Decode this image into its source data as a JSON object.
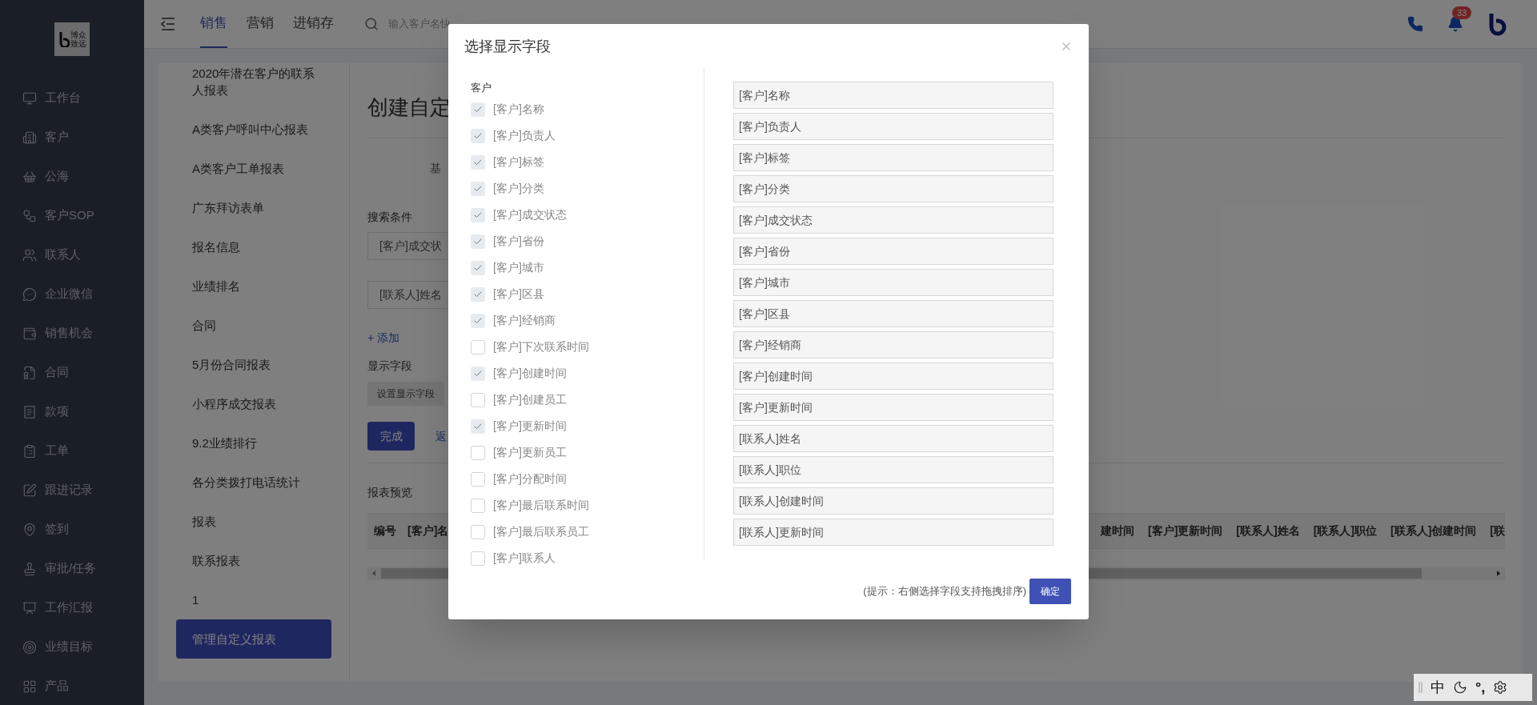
{
  "sidebar": {
    "logo_text": "博众致远",
    "items": [
      {
        "label": "工作台",
        "kind": "monitor"
      },
      {
        "label": "客户",
        "kind": "building"
      },
      {
        "label": "公海",
        "kind": "basket"
      },
      {
        "label": "客户SOP",
        "kind": "sop"
      },
      {
        "label": "联系人",
        "kind": "users"
      },
      {
        "label": "企业微信",
        "kind": "chat"
      },
      {
        "label": "销售机会",
        "kind": "moneybag"
      },
      {
        "label": "合同",
        "kind": "contract"
      },
      {
        "label": "款项",
        "kind": "payment"
      },
      {
        "label": "工单",
        "kind": "clipboard"
      },
      {
        "label": "跟进记录",
        "kind": "edit"
      },
      {
        "label": "签到",
        "kind": "pin"
      },
      {
        "label": "审批/任务",
        "kind": "stamp"
      },
      {
        "label": "工作汇报",
        "kind": "presentation"
      },
      {
        "label": "业绩目标",
        "kind": "target"
      },
      {
        "label": "产品",
        "kind": "grid"
      }
    ]
  },
  "topbar": {
    "tabs": [
      {
        "label": "销售",
        "selected": true
      },
      {
        "label": "营销",
        "selected": false
      },
      {
        "label": "进销存",
        "selected": false
      }
    ],
    "search": {
      "placeholder": "输入客户名快"
    },
    "notification_count": "33"
  },
  "report_list": {
    "items": [
      {
        "label": "2020年潜在客户的联系人报表",
        "selected": false
      },
      {
        "label": "A类客户呼叫中心报表",
        "selected": false
      },
      {
        "label": "A类客户工单报表",
        "selected": false
      },
      {
        "label": "广东拜访表单",
        "selected": false
      },
      {
        "label": "报名信息",
        "selected": false
      },
      {
        "label": "业绩排名",
        "selected": false
      },
      {
        "label": "合同",
        "selected": false
      },
      {
        "label": "5月份合同报表",
        "selected": false
      },
      {
        "label": "小程序成交报表",
        "selected": false
      },
      {
        "label": "9.2业绩排行",
        "selected": false
      },
      {
        "label": "各分类拨打电话统计",
        "selected": false
      },
      {
        "label": "报表",
        "selected": false
      },
      {
        "label": "联系报表",
        "selected": false
      },
      {
        "label": "1",
        "selected": false
      },
      {
        "label": "管理自定义报表",
        "selected": true
      }
    ]
  },
  "editor": {
    "title": "创建自定",
    "tab": "基",
    "search_label": "搜索条件",
    "conditions": [
      "[客户]成交状",
      "[联系人]姓名"
    ],
    "add_link": "+ 添加",
    "display_label": "显示字段",
    "set_fields_button": "设置显示字段",
    "done_button": "完成",
    "back_link": "返",
    "preview_label": "报表预览",
    "table": {
      "columns_left": [
        "编号",
        "[客户]名"
      ],
      "columns_right": [
        "建时间",
        "[客户]更新时间",
        "[联系人]姓名",
        "[联系人]职位",
        "[联系人]创建时间",
        "[联"
      ]
    }
  },
  "modal": {
    "title": "选择显示字段",
    "group": "客户",
    "options": [
      {
        "label": "[客户]名称",
        "checked": true
      },
      {
        "label": "[客户]负责人",
        "checked": true
      },
      {
        "label": "[客户]标签",
        "checked": true
      },
      {
        "label": "[客户]分类",
        "checked": true
      },
      {
        "label": "[客户]成交状态",
        "checked": true
      },
      {
        "label": "[客户]省份",
        "checked": true
      },
      {
        "label": "[客户]城市",
        "checked": true
      },
      {
        "label": "[客户]区县",
        "checked": true
      },
      {
        "label": "[客户]经销商",
        "checked": true
      },
      {
        "label": "[客户]下次联系时间",
        "checked": false
      },
      {
        "label": "[客户]创建时间",
        "checked": true
      },
      {
        "label": "[客户]创建员工",
        "checked": false
      },
      {
        "label": "[客户]更新时间",
        "checked": true
      },
      {
        "label": "[客户]更新员工",
        "checked": false
      },
      {
        "label": "[客户]分配时间",
        "checked": false
      },
      {
        "label": "[客户]最后联系时间",
        "checked": false
      },
      {
        "label": "[客户]最后联系员工",
        "checked": false
      },
      {
        "label": "[客户]联系人",
        "checked": false
      }
    ],
    "selected_fields": [
      "[客户]名称",
      "[客户]负责人",
      "[客户]标签",
      "[客户]分类",
      "[客户]成交状态",
      "[客户]省份",
      "[客户]城市",
      "[客户]区县",
      "[客户]经销商",
      "[客户]创建时间",
      "[客户]更新时间",
      "[联系人]姓名",
      "[联系人]职位",
      "[联系人]创建时间",
      "[联系人]更新时间"
    ],
    "hint": "(提示：右侧选择字段支持拖拽排序)",
    "confirm_button": "确定"
  },
  "ime": {
    "mode": "中",
    "punctuation": "°,"
  }
}
